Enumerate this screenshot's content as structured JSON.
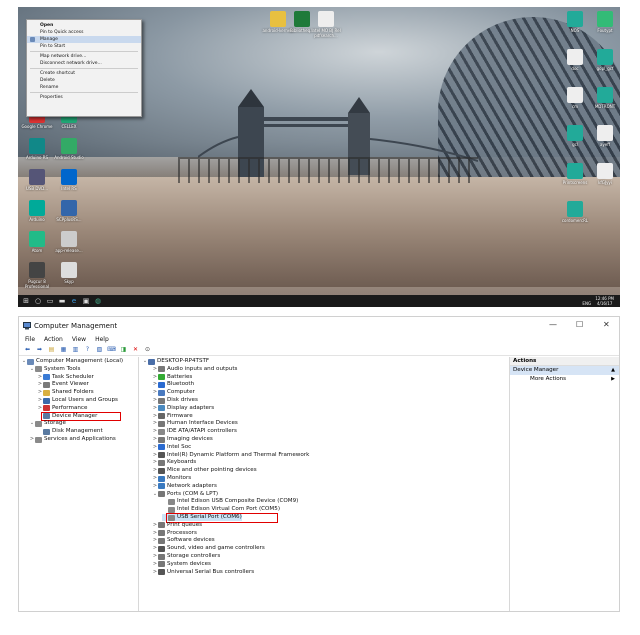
{
  "desktop": {
    "context_menu": [
      {
        "label": "Open",
        "bold": true
      },
      {
        "label": "Pin to Quick access"
      },
      {
        "label": "Manage",
        "highlight": true
      },
      {
        "label": "Pin to Start"
      },
      {
        "sep": true
      },
      {
        "label": "Map network drive..."
      },
      {
        "label": "Disconnect network drive..."
      },
      {
        "sep": true
      },
      {
        "label": "Create shortcut"
      },
      {
        "label": "Delete"
      },
      {
        "label": "Rename"
      },
      {
        "sep": true
      },
      {
        "label": "Properties"
      }
    ],
    "left_icons": [
      {
        "label": "Google Chrome",
        "color": "#d33"
      },
      {
        "label": "CELLEX",
        "color": "#2a7"
      },
      {
        "label": "Arduino RS",
        "color": "#188"
      },
      {
        "label": "Android Studio",
        "color": "#3a6"
      },
      {
        "label": "USB DVD...",
        "color": "#557"
      },
      {
        "label": "Intel RS",
        "color": "#06c"
      },
      {
        "label": "Arduino",
        "color": "#0a9"
      },
      {
        "label": "SCPplusRS...",
        "color": "#36a"
      },
      {
        "label": "Atom",
        "color": "#2b8"
      },
      {
        "label": "app-release...",
        "color": "#ccc"
      },
      {
        "label": "Pugcur 8 Professional",
        "color": "#444"
      },
      {
        "label": "Skyp",
        "color": "#ddd"
      }
    ],
    "top_icons": [
      {
        "label": "android-kernels",
        "color": "#e8c040"
      },
      {
        "label": "Bibliotheq...",
        "color": "#1e7a3a"
      },
      {
        "label": "Intel MO BJ Rel pdfsearch...",
        "color": "#eee"
      }
    ],
    "right_icons": [
      {
        "label": "NOS",
        "color": "#2a9"
      },
      {
        "label": "Foutypt",
        "color": "#3b7"
      },
      {
        "label": "doc",
        "color": "#eee"
      },
      {
        "label": "gopl_gcf",
        "color": "#2a9"
      },
      {
        "label": "cm",
        "color": "#eee"
      },
      {
        "label": "MDTRONT",
        "color": "#2a9"
      },
      {
        "label": "gcl",
        "color": "#2a9"
      },
      {
        "label": "ayeff",
        "color": "#eee"
      },
      {
        "label": "Printscreens",
        "color": "#2a9"
      },
      {
        "label": "kfGJyyi",
        "color": "#eee"
      },
      {
        "label": "cordomercRL",
        "color": "#2a9"
      }
    ],
    "taskbar": {
      "tray_time": "12:46 PM",
      "tray_date": "4/16/17",
      "tray_lang": "ENG"
    }
  },
  "window": {
    "title": "Computer Management",
    "menu": [
      "File",
      "Action",
      "View",
      "Help"
    ],
    "left_tree": [
      {
        "label": "Computer Management (Local)",
        "indent": 0,
        "arrow": "⌄",
        "color": "#6a8ab8"
      },
      {
        "label": "System Tools",
        "indent": 1,
        "arrow": "⌄",
        "color": "#8a8a8a"
      },
      {
        "label": "Task Scheduler",
        "indent": 2,
        "arrow": ">",
        "color": "#3a7bd5"
      },
      {
        "label": "Event Viewer",
        "indent": 2,
        "arrow": ">",
        "color": "#7a7a7a"
      },
      {
        "label": "Shared Folders",
        "indent": 2,
        "arrow": ">",
        "color": "#d9b040"
      },
      {
        "label": "Local Users and Groups",
        "indent": 2,
        "arrow": ">",
        "color": "#3a6aaa"
      },
      {
        "label": "Performance",
        "indent": 2,
        "arrow": ">",
        "color": "#c33"
      },
      {
        "label": "Device Manager",
        "indent": 2,
        "arrow": "",
        "color": "#5a7aa0",
        "boxed": true
      },
      {
        "label": "Storage",
        "indent": 1,
        "arrow": "⌄",
        "color": "#8a8a8a"
      },
      {
        "label": "Disk Management",
        "indent": 2,
        "arrow": "",
        "color": "#5a7aa0"
      },
      {
        "label": "Services and Applications",
        "indent": 1,
        "arrow": ">",
        "color": "#8a8a8a"
      }
    ],
    "device_tree": [
      {
        "label": "DESKTOP-RP4TSTF",
        "indent": 0,
        "arrow": "⌄",
        "color": "#4a6ea8"
      },
      {
        "label": "Audio inputs and outputs",
        "indent": 1,
        "arrow": ">",
        "color": "#777"
      },
      {
        "label": "Batteries",
        "indent": 1,
        "arrow": ">",
        "color": "#3a3"
      },
      {
        "label": "Bluetooth",
        "indent": 1,
        "arrow": ">",
        "color": "#2a6ad0"
      },
      {
        "label": "Computer",
        "indent": 1,
        "arrow": ">",
        "color": "#4a7ac0"
      },
      {
        "label": "Disk drives",
        "indent": 1,
        "arrow": ">",
        "color": "#777"
      },
      {
        "label": "Display adapters",
        "indent": 1,
        "arrow": ">",
        "color": "#4a8ac0"
      },
      {
        "label": "Firmware",
        "indent": 1,
        "arrow": ">",
        "color": "#666"
      },
      {
        "label": "Human Interface Devices",
        "indent": 1,
        "arrow": ">",
        "color": "#777"
      },
      {
        "label": "IDE ATA/ATAPI controllers",
        "indent": 1,
        "arrow": ">",
        "color": "#888"
      },
      {
        "label": "Imaging devices",
        "indent": 1,
        "arrow": ">",
        "color": "#777"
      },
      {
        "label": "Intel Soc",
        "indent": 1,
        "arrow": ">",
        "color": "#2a6ad0"
      },
      {
        "label": "Intel(R) Dynamic Platform and Thermal Framework",
        "indent": 1,
        "arrow": ">",
        "color": "#555"
      },
      {
        "label": "Keyboards",
        "indent": 1,
        "arrow": ">",
        "color": "#777"
      },
      {
        "label": "Mice and other pointing devices",
        "indent": 1,
        "arrow": ">",
        "color": "#555"
      },
      {
        "label": "Monitors",
        "indent": 1,
        "arrow": ">",
        "color": "#3a7ac0"
      },
      {
        "label": "Network adapters",
        "indent": 1,
        "arrow": ">",
        "color": "#3a7ac0"
      },
      {
        "label": "Ports (COM & LPT)",
        "indent": 1,
        "arrow": "⌄",
        "color": "#777"
      },
      {
        "label": "Intel Edison USB Composite Device (COM9)",
        "indent": 2,
        "arrow": "",
        "color": "#888"
      },
      {
        "label": "Intel Edison Virtual Com Port (COM5)",
        "indent": 2,
        "arrow": "",
        "color": "#888"
      },
      {
        "label": "USB Serial Port (COM6)",
        "indent": 2,
        "arrow": "",
        "color": "#888",
        "selected": true,
        "boxed": true
      },
      {
        "label": "Print queues",
        "indent": 1,
        "arrow": ">",
        "color": "#777"
      },
      {
        "label": "Processors",
        "indent": 1,
        "arrow": ">",
        "color": "#777"
      },
      {
        "label": "Software devices",
        "indent": 1,
        "arrow": ">",
        "color": "#777"
      },
      {
        "label": "Sound, video and game controllers",
        "indent": 1,
        "arrow": ">",
        "color": "#555"
      },
      {
        "label": "Storage controllers",
        "indent": 1,
        "arrow": ">",
        "color": "#777"
      },
      {
        "label": "System devices",
        "indent": 1,
        "arrow": ">",
        "color": "#777"
      },
      {
        "label": "Universal Serial Bus controllers",
        "indent": 1,
        "arrow": ">",
        "color": "#555"
      }
    ],
    "actions": {
      "header": "Actions",
      "section": "Device Manager",
      "items": [
        "More Actions"
      ]
    }
  },
  "highlight_color": "#e00000"
}
